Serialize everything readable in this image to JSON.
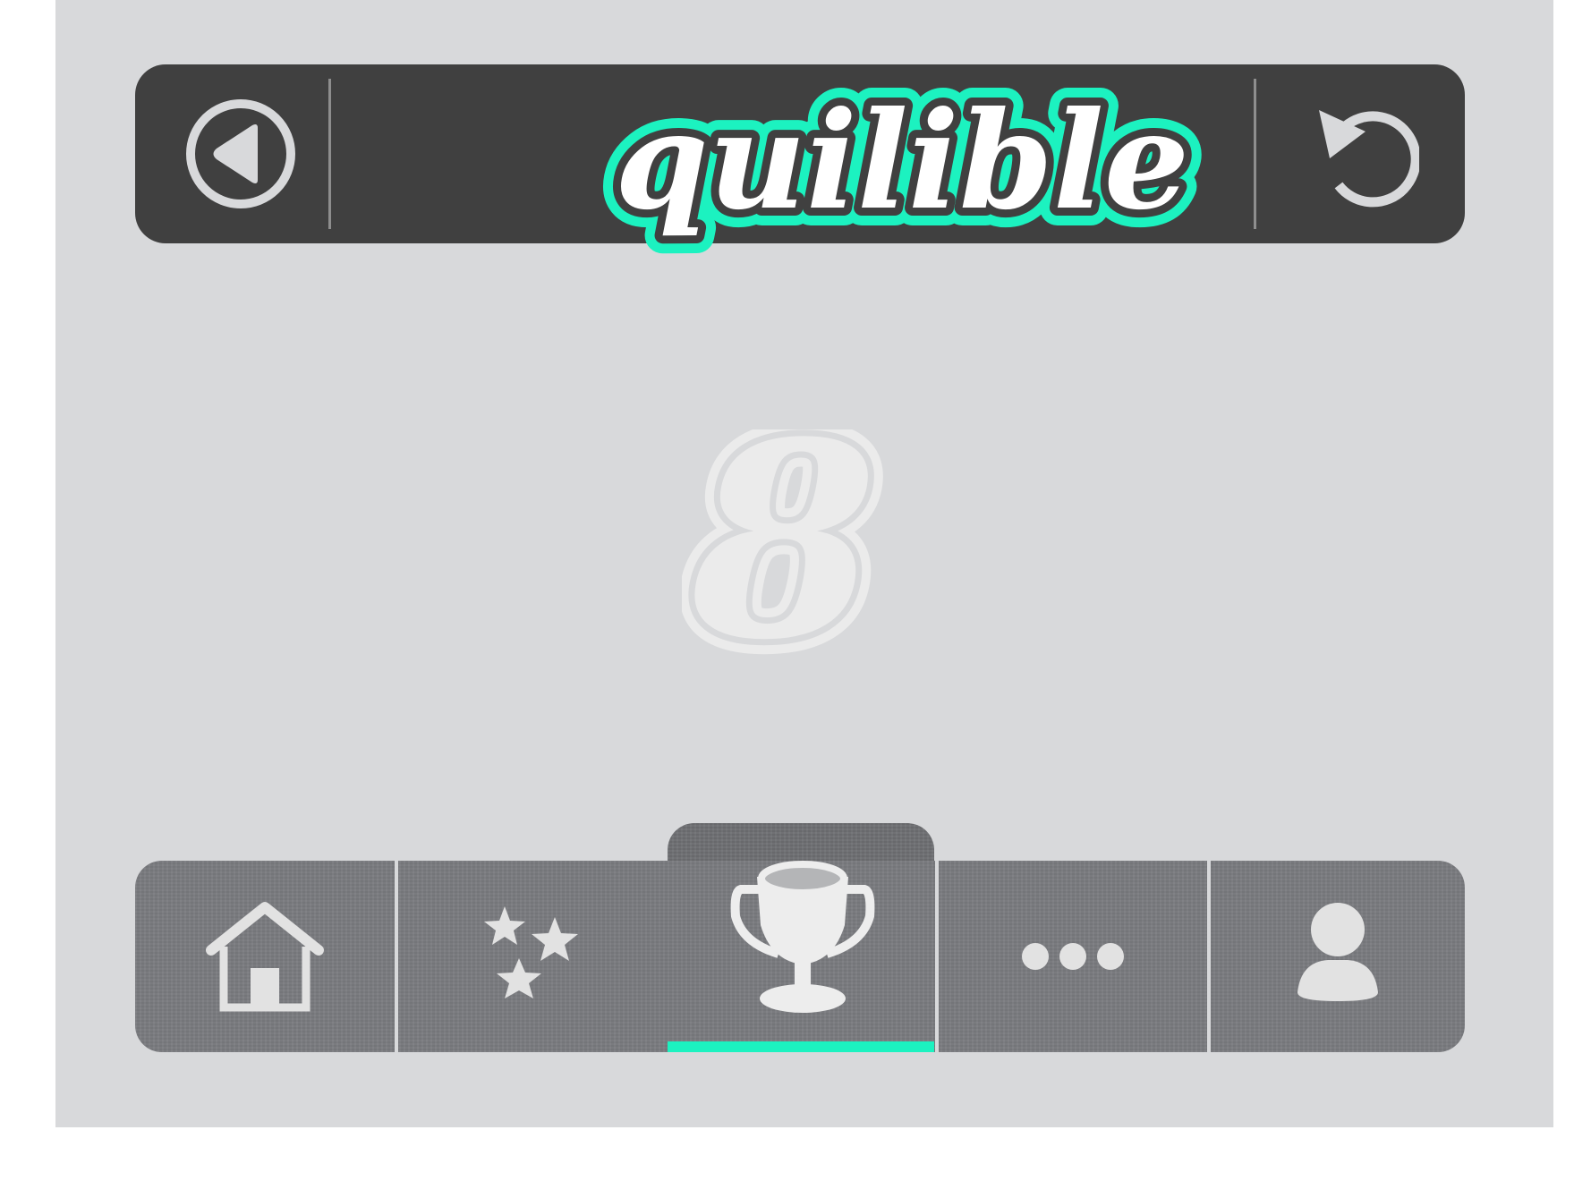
{
  "app": {
    "logo_text": "quilible",
    "brand_color": "#1cf2c0",
    "header_color": "#404040",
    "background_color": "#d8d9db"
  },
  "header": {
    "back_icon": "back-circle-icon",
    "refresh_icon": "refresh-icon"
  },
  "center_mark": {
    "icon": "quilible-q-mark-icon"
  },
  "tabs": [
    {
      "id": "home",
      "icon": "home-icon"
    },
    {
      "id": "stars",
      "icon": "stars-icon"
    },
    {
      "id": "leaderboard",
      "icon": "trophy-icon",
      "active": true
    },
    {
      "id": "more",
      "icon": "more-dots-icon"
    },
    {
      "id": "profile",
      "icon": "person-icon"
    }
  ]
}
